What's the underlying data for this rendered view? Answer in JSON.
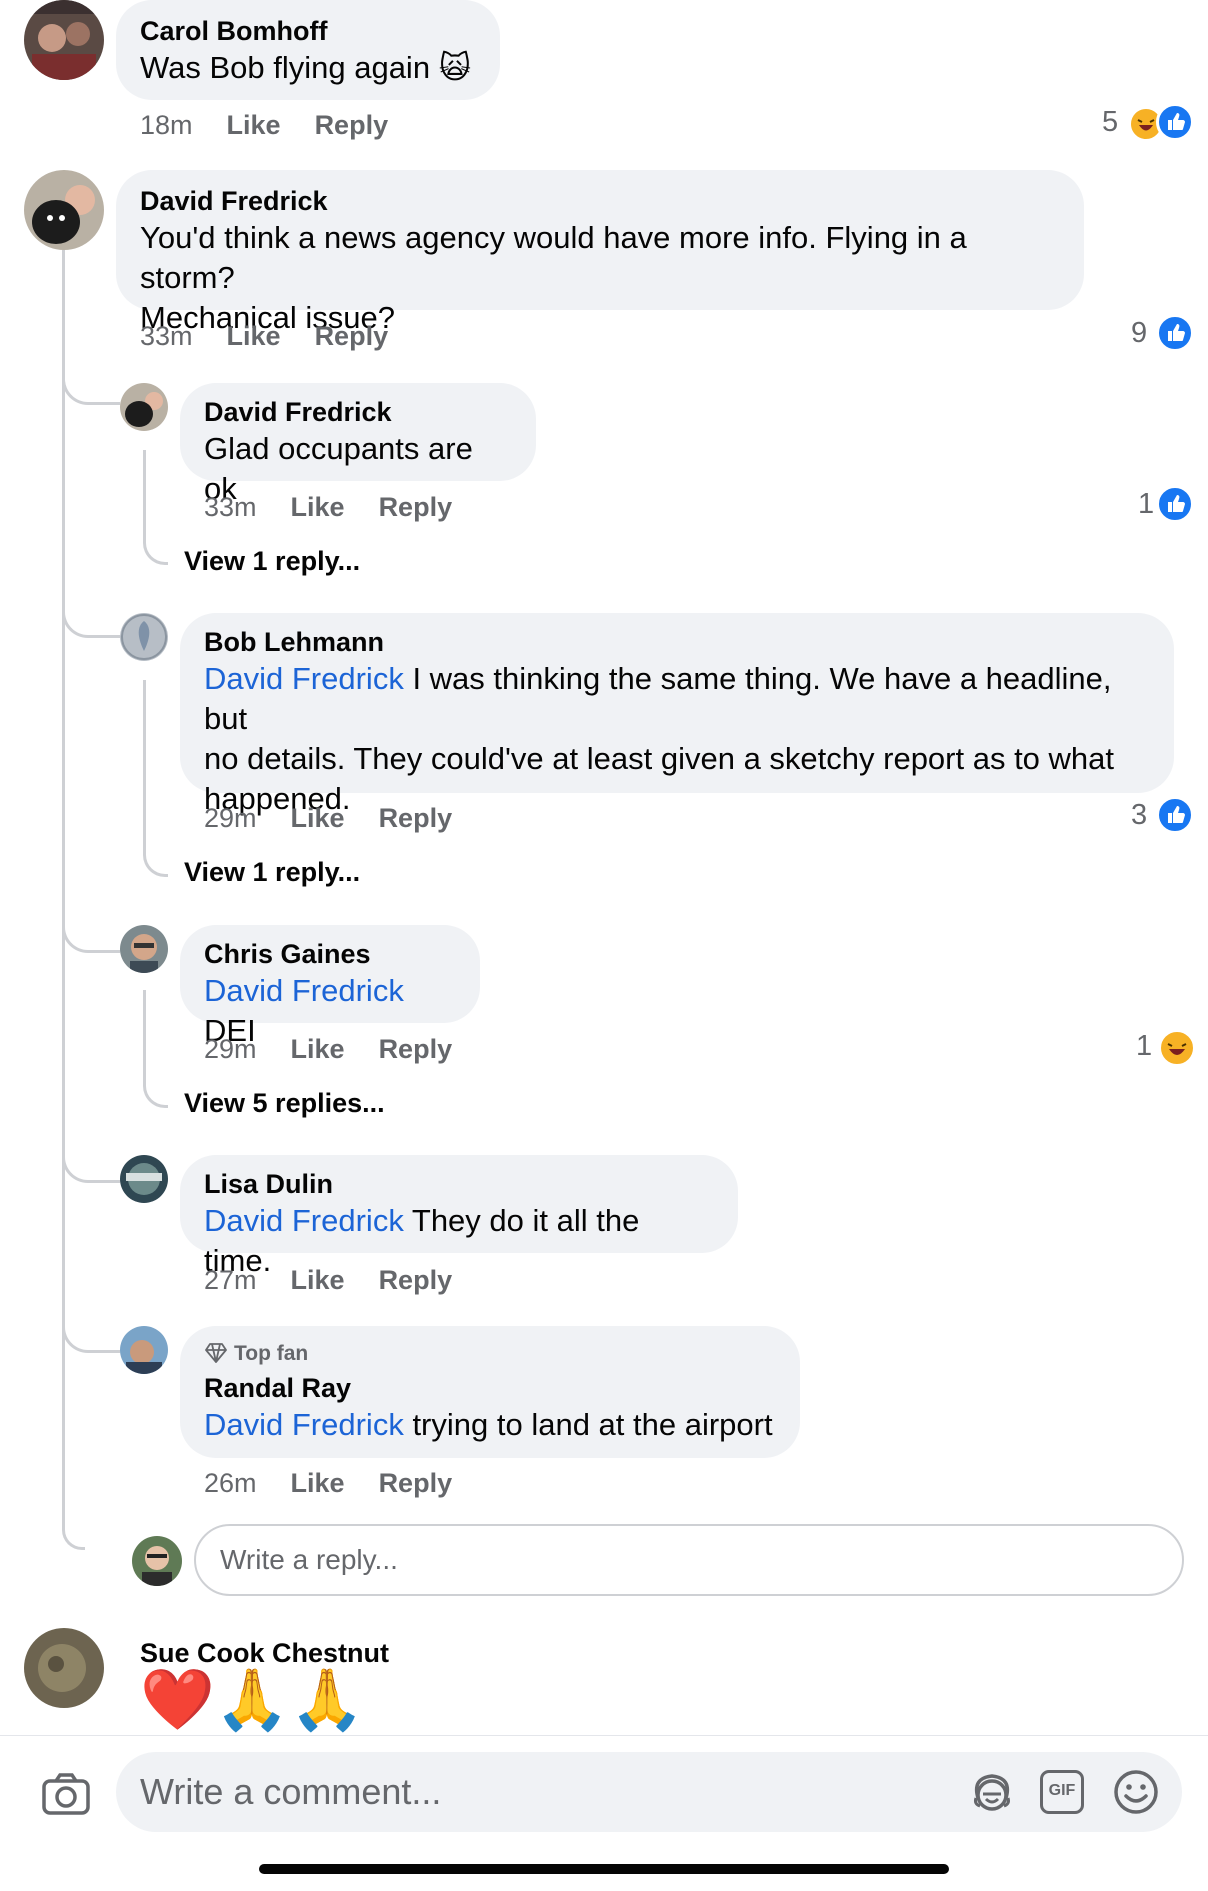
{
  "actions": {
    "like": "Like",
    "reply": "Reply"
  },
  "comments": {
    "carol": {
      "name": "Carol Bomhoff",
      "text": "Was Bob flying again",
      "emoji": "🙀",
      "time": "18m",
      "reaction_count": "5",
      "reactions": [
        "haha",
        "like"
      ]
    },
    "david": {
      "name": "David Fredrick",
      "text_line1": "You'd think a news agency would have more info. Flying in a storm?",
      "text_line2": "Mechanical issue?",
      "time": "33m",
      "reaction_count": "9",
      "reactions": [
        "like"
      ]
    },
    "sue": {
      "name": "Sue Cook Chestnut",
      "emojis": [
        "❤️",
        "🙏",
        "🙏"
      ]
    }
  },
  "replies": [
    {
      "name": "David Fredrick",
      "text": "Glad occupants are ok",
      "time": "33m",
      "reaction_count": "1",
      "reactions": [
        "like"
      ],
      "view_replies": "View 1 reply..."
    },
    {
      "name": "Bob Lehmann",
      "mention": "David Fredrick",
      "text_line1": " I was thinking the same thing. We have a headline, but",
      "text_line2": "no details. They could've at least given a sketchy report as to what",
      "text_line3": "happened.",
      "time": "29m",
      "reaction_count": "3",
      "reactions": [
        "like"
      ],
      "view_replies": "View 1 reply..."
    },
    {
      "name": "Chris Gaines",
      "mention": "David Fredrick",
      "text": " DEI",
      "time": "29m",
      "reaction_count": "1",
      "reactions": [
        "haha"
      ],
      "view_replies": "View 5 replies..."
    },
    {
      "name": "Lisa Dulin",
      "mention": "David Fredrick",
      "text": " They do it all the time.",
      "time": "27m"
    },
    {
      "badge": "Top fan",
      "badge_icon": "diamond-icon",
      "name": "Randal Ray",
      "mention": "David Fredrick",
      "text": " trying to land at the airport",
      "time": "26m"
    }
  ],
  "reply_box": {
    "placeholder": "Write a reply..."
  },
  "composer": {
    "placeholder": "Write a comment...",
    "icons": [
      "camera-icon",
      "avatar-sticker-icon",
      "gif-icon",
      "emoji-icon"
    ],
    "gif_label": "GIF"
  },
  "colors": {
    "bubble": "#f0f2f5",
    "mention": "#1c64d6",
    "like": "#1877f2",
    "meta": "#65676b"
  }
}
